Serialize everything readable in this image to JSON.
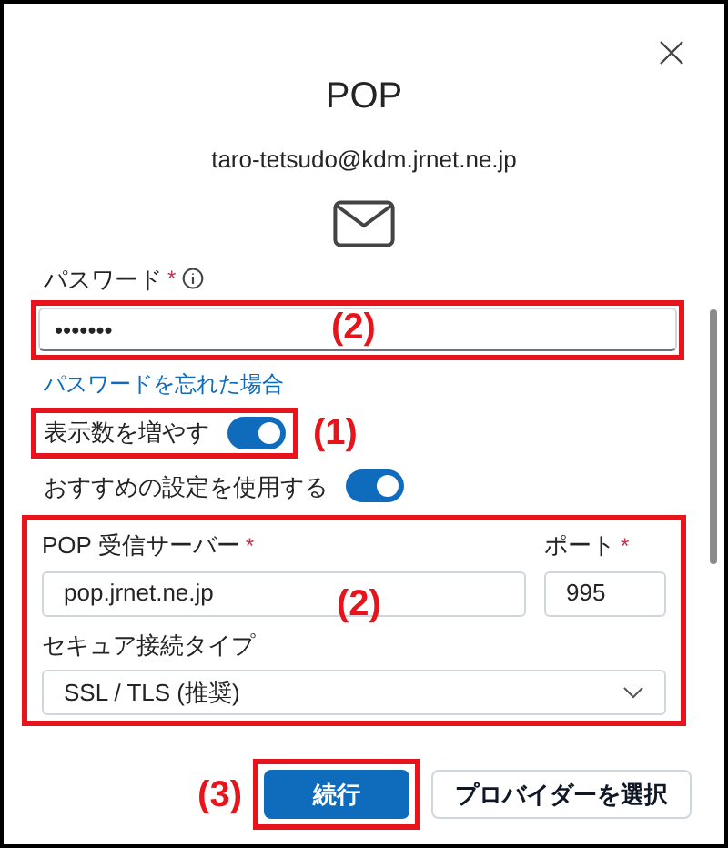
{
  "dialog": {
    "title": "POP",
    "email": "taro-tetsudo@kdm.jrnet.ne.jp"
  },
  "password": {
    "label": "パスワード",
    "required_mark": "*",
    "value": "•••••••",
    "forgot_link": "パスワードを忘れた場合"
  },
  "toggles": [
    {
      "label": "表示数を増やす",
      "on": true
    },
    {
      "label": "おすすめの設定を使用する",
      "on": true
    }
  ],
  "server": {
    "label": "POP 受信サーバー",
    "required_mark": "*",
    "value": "pop.jrnet.ne.jp"
  },
  "port": {
    "label": "ポート",
    "required_mark": "*",
    "value": "995"
  },
  "security": {
    "label": "セキュア接続タイプ",
    "value": "SSL / TLS (推奨)"
  },
  "buttons": [
    {
      "label": "続行",
      "kind": "primary"
    },
    {
      "label": "プロバイダーを選択",
      "kind": "secondary"
    }
  ],
  "annotations": [
    {
      "label": "(2)"
    },
    {
      "label": "(1)"
    },
    {
      "label": "(2)"
    },
    {
      "label": "(3)"
    }
  ]
}
